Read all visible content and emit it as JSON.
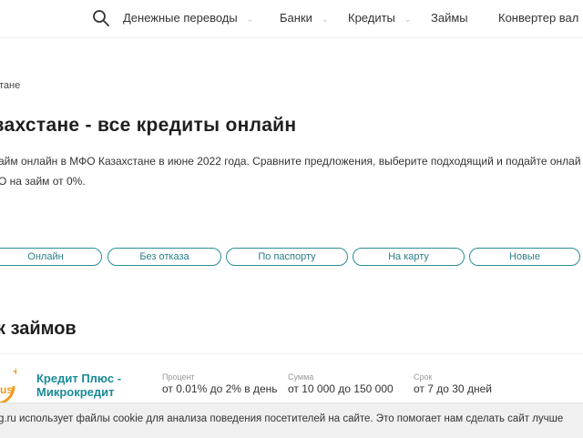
{
  "header": {
    "nav": [
      {
        "label": "Денежные переводы",
        "has_dropdown": true
      },
      {
        "label": "Банки",
        "has_dropdown": true
      },
      {
        "label": "Кредиты",
        "has_dropdown": true
      },
      {
        "label": "Займы",
        "has_dropdown": false
      },
      {
        "label": "Конвертер вал",
        "has_dropdown": false
      }
    ],
    "search_icon": "search-icon",
    "dropdown_icon": "chevron-down-icon",
    "chevron_glyph": "⌄"
  },
  "breadcrumb": {
    "text": "тане"
  },
  "page": {
    "title": "захстане - все кредиты онлайн",
    "intro_line1": "айм онлайн в МФО Казахстане в июне 2022 года. Сравните предложения, выберите подходящий и подайте онлай",
    "intro_line2": "О на займ от 0%."
  },
  "filters": [
    "Онлайн",
    "Без отказа",
    "По паспорту",
    "На карту",
    "Новые"
  ],
  "section": {
    "title": "к займов"
  },
  "offer": {
    "name_line1": "Кредит Плюс -",
    "name_line2": "Микрокредит",
    "logo_text": "us",
    "rate_label": "Процент",
    "rate_value": "от 0.01% до 2% в день",
    "amount_label": "Сумма",
    "amount_value": "от 10 000 до 150 000",
    "term_label": "Срок",
    "term_value": "от 7 до 30 дней"
  },
  "cookie_notice": {
    "text": "g.ru использует файлы cookie для анализа поведения посетителей на сайте. Это помогает нам сделать сайт лучше"
  },
  "colors": {
    "accent": "#2a8f9a",
    "logo_orange": "#f39a1e"
  }
}
